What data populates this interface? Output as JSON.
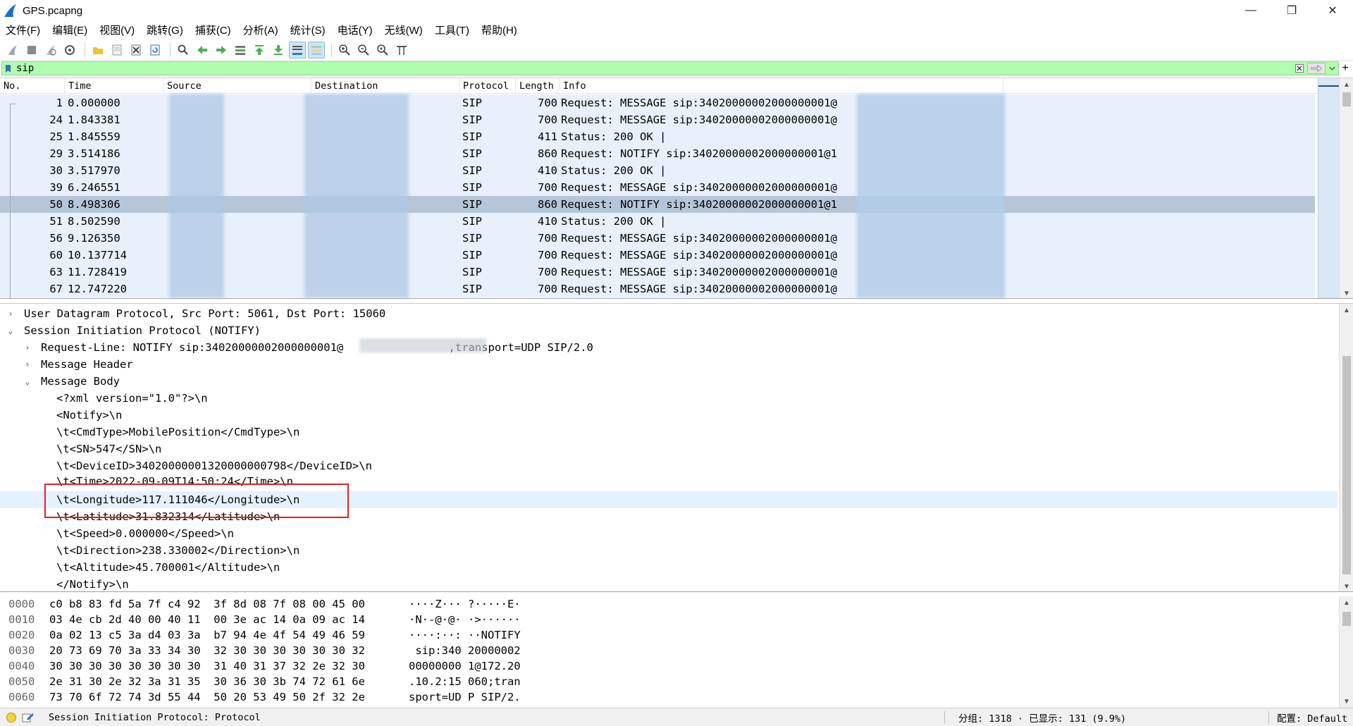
{
  "window": {
    "title": "GPS.pcapng",
    "minimize": "—",
    "restore": "❐",
    "close": "✕"
  },
  "menu": [
    "文件(F)",
    "编辑(E)",
    "视图(V)",
    "跳转(G)",
    "捕获(C)",
    "分析(A)",
    "统计(S)",
    "电话(Y)",
    "无线(W)",
    "工具(T)",
    "帮助(H)"
  ],
  "toolbar_icons": [
    "start-capture-icon",
    "stop-capture-icon",
    "restart-capture-icon",
    "capture-options-icon",
    "open-file-icon",
    "save-file-icon",
    "close-file-icon",
    "reload-file-icon",
    "find-packet-icon",
    "go-back-icon",
    "go-forward-icon",
    "go-to-packet-icon",
    "go-first-icon",
    "go-last-icon",
    "autoscroll-icon",
    "colorize-icon",
    "zoom-in-icon",
    "zoom-out-icon",
    "zoom-normal-icon",
    "resize-columns-icon"
  ],
  "filter": {
    "value": "sip",
    "background": "#afffaf"
  },
  "packet_list": {
    "columns": [
      "No.",
      "Time",
      "Source",
      "Destination",
      "Protocol",
      "Length",
      "Info"
    ],
    "rows": [
      {
        "no": "1",
        "time": "0.000000",
        "protocol": "SIP",
        "length": "700",
        "info": "Request: MESSAGE sip:34020000002000000001@"
      },
      {
        "no": "24",
        "time": "1.843381",
        "protocol": "SIP",
        "length": "700",
        "info": "Request: MESSAGE sip:34020000002000000001@"
      },
      {
        "no": "25",
        "time": "1.845559",
        "protocol": "SIP",
        "length": "411",
        "info": "Status: 200 OK |"
      },
      {
        "no": "29",
        "time": "3.514186",
        "protocol": "SIP",
        "length": "860",
        "info": "Request: NOTIFY sip:34020000002000000001@1"
      },
      {
        "no": "30",
        "time": "3.517970",
        "protocol": "SIP",
        "length": "410",
        "info": "Status: 200 OK |"
      },
      {
        "no": "39",
        "time": "6.246551",
        "protocol": "SIP",
        "length": "700",
        "info": "Request: MESSAGE sip:34020000002000000001@"
      },
      {
        "no": "50",
        "time": "8.498306",
        "protocol": "SIP",
        "length": "860",
        "info": "Request: NOTIFY sip:34020000002000000001@1"
      },
      {
        "no": "51",
        "time": "8.502590",
        "protocol": "SIP",
        "length": "410",
        "info": "Status: 200 OK |"
      },
      {
        "no": "56",
        "time": "9.126350",
        "protocol": "SIP",
        "length": "700",
        "info": "Request: MESSAGE sip:34020000002000000001@"
      },
      {
        "no": "60",
        "time": "10.137714",
        "protocol": "SIP",
        "length": "700",
        "info": "Request: MESSAGE sip:34020000002000000001@"
      },
      {
        "no": "63",
        "time": "11.728419",
        "protocol": "SIP",
        "length": "700",
        "info": "Request: MESSAGE sip:34020000002000000001@"
      },
      {
        "no": "67",
        "time": "12.747220",
        "protocol": "SIP",
        "length": "700",
        "info": "Request: MESSAGE sip:34020000002000000001@"
      }
    ],
    "selected_no": "50",
    "row_color": "#e7f0fb",
    "selected_color": "#b5c6d8"
  },
  "details": {
    "lines": [
      {
        "expander": "›",
        "text": "User Datagram Protocol, Src Port: 5061, Dst Port: 15060"
      },
      {
        "expander": "⌄",
        "text": "Session Initiation Protocol (NOTIFY)"
      },
      {
        "expander": "›",
        "text": "Request-Line: NOTIFY sip:34020000002000000001@                ,transport=UDP SIP/2.0"
      },
      {
        "expander": "›",
        "text": "Message Header"
      },
      {
        "expander": "⌄",
        "text": "Message Body"
      },
      {
        "expander": "",
        "text": "<?xml version=\"1.0\"?>\\n"
      },
      {
        "expander": "",
        "text": "<Notify>\\n"
      },
      {
        "expander": "",
        "text": "\\t<CmdType>MobilePosition</CmdType>\\n"
      },
      {
        "expander": "",
        "text": "\\t<SN>547</SN>\\n"
      },
      {
        "expander": "",
        "text": "\\t<DeviceID>34020000001320000000798</DeviceID>\\n"
      },
      {
        "expander": "",
        "text": "\\t<Time>2022-09-09T14:50:24</Time>\\n"
      },
      {
        "expander": "",
        "text": "\\t<Longitude>117.111046</Longitude>\\n"
      },
      {
        "expander": "",
        "text": "\\t<Latitude>31.832314</Latitude>\\n"
      },
      {
        "expander": "",
        "text": "\\t<Speed>0.000000</Speed>\\n"
      },
      {
        "expander": "",
        "text": "\\t<Direction>238.330002</Direction>\\n"
      },
      {
        "expander": "",
        "text": "\\t<Altitude>45.700001</Altitude>\\n"
      },
      {
        "expander": "",
        "text": "</Notify>\\n"
      }
    ],
    "highlight_color": "#e5f1ff",
    "annotation_color": "#e02020"
  },
  "bytes": [
    {
      "offset": "0000",
      "hex": "c0 b8 83 fd 5a 7f c4 92  3f 8d 08 7f 08 00 45 00",
      "ascii": "····Z··· ?·····E·"
    },
    {
      "offset": "0010",
      "hex": "03 4e cb 2d 40 00 40 11  00 3e ac 14 0a 09 ac 14",
      "ascii": "·N·-@·@· ·>······"
    },
    {
      "offset": "0020",
      "hex": "0a 02 13 c5 3a d4 03 3a  b7 94 4e 4f 54 49 46 59",
      "ascii": "····:··: ··NOTIFY"
    },
    {
      "offset": "0030",
      "hex": "20 73 69 70 3a 33 34 30  32 30 30 30 30 30 30 32",
      "ascii": " sip:340 20000002"
    },
    {
      "offset": "0040",
      "hex": "30 30 30 30 30 30 30 30  31 40 31 37 32 2e 32 30",
      "ascii": "00000000 1@172.20"
    },
    {
      "offset": "0050",
      "hex": "2e 31 30 2e 32 3a 31 35  30 36 30 3b 74 72 61 6e",
      "ascii": ".10.2:15 060;tran"
    },
    {
      "offset": "0060",
      "hex": "73 70 6f 72 74 3d 55 44  50 20 53 49 50 2f 32 2e",
      "ascii": "sport=UD P SIP/2."
    }
  ],
  "status": {
    "text": "Session Initiation Protocol: Protocol",
    "stats": "分组: 1318 · 已显示: 131 (9.9%)",
    "profile": "配置: Default",
    "led_color": "#f4d33d"
  }
}
